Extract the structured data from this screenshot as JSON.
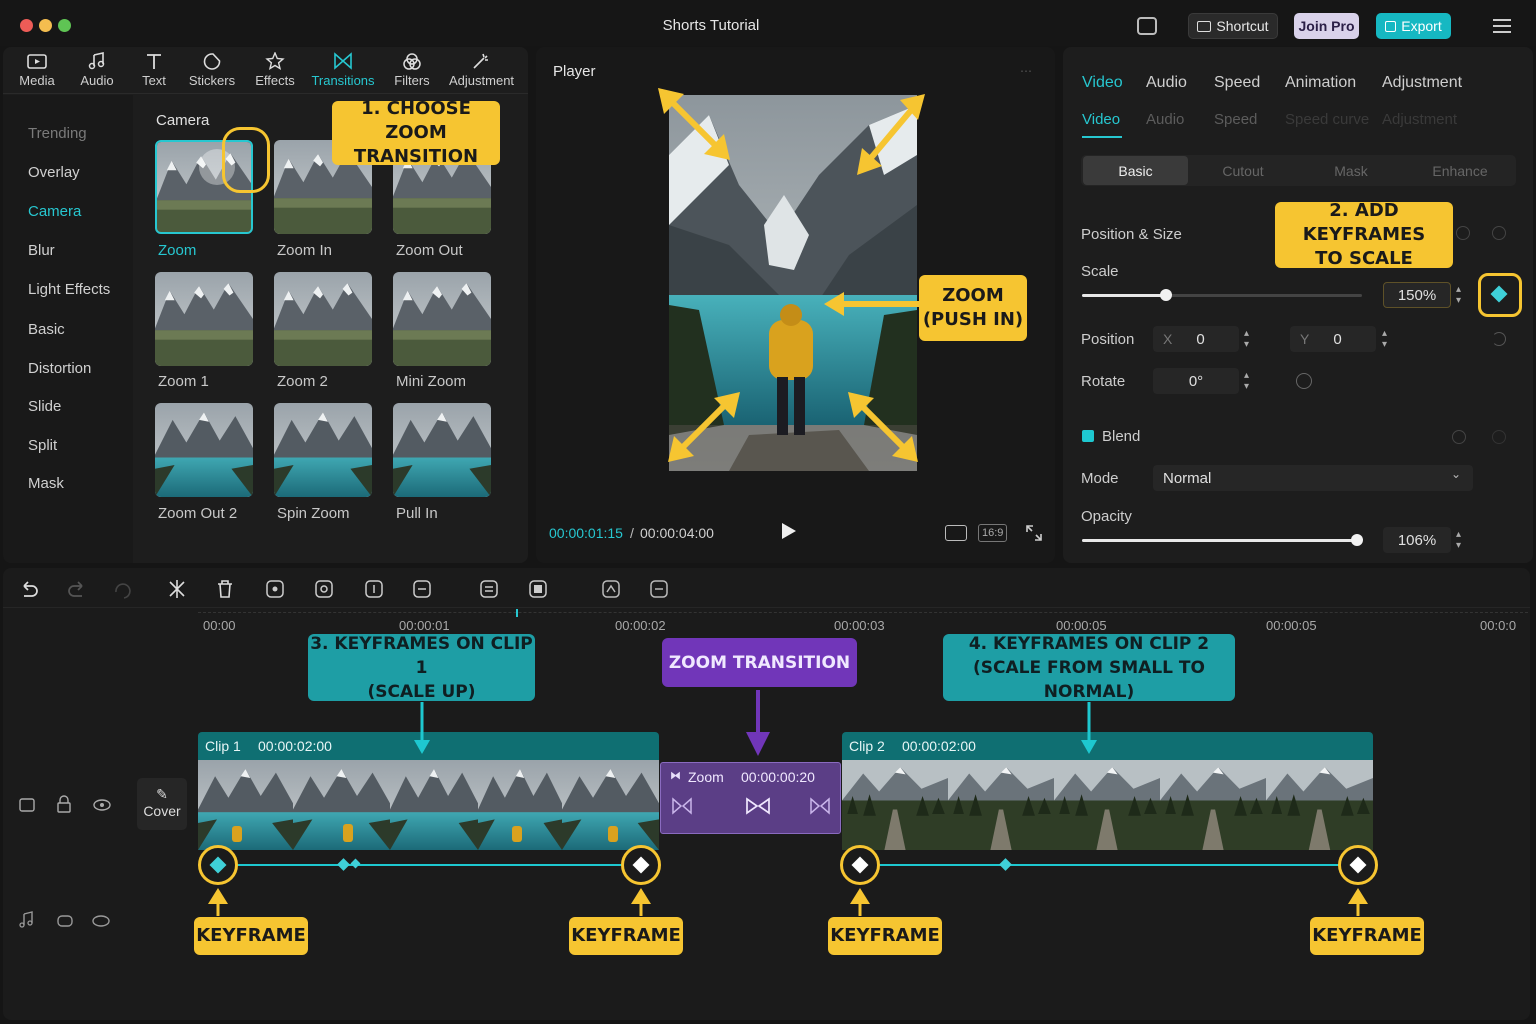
{
  "window": {
    "title": "Shorts Tutorial"
  },
  "header": {
    "shortcut_label": "Shortcut",
    "joinpro_label": "Join Pro",
    "export_label": "Export"
  },
  "toolbar": {
    "items": [
      {
        "label": "Media",
        "icon": "media-icon"
      },
      {
        "label": "Audio",
        "icon": "audio-icon"
      },
      {
        "label": "Text",
        "icon": "text-icon"
      },
      {
        "label": "Stickers",
        "icon": "stickers-icon"
      },
      {
        "label": "Effects",
        "icon": "effects-icon"
      },
      {
        "label": "Transitions",
        "icon": "transitions-icon",
        "active": true
      },
      {
        "label": "Filters",
        "icon": "filters-icon"
      },
      {
        "label": "Adjustment",
        "icon": "adjustment-icon"
      }
    ]
  },
  "categories": [
    "Trending",
    "Overlay",
    "Camera",
    "Blur",
    "Light Effects",
    "Basic",
    "Distortion",
    "Slide",
    "Split",
    "Mask"
  ],
  "active_category": "Camera",
  "transitions": {
    "section_title": "Camera",
    "items": [
      "Zoom",
      "Zoom In",
      "Zoom Out",
      "Zoom 1",
      "Zoom 2",
      "Mini Zoom",
      "Zoom Out 2",
      "Spin Zoom",
      "Pull In"
    ],
    "selected": "Zoom"
  },
  "player": {
    "title": "Player",
    "current_time": "00:00:01:15",
    "separator": "/",
    "total_time": "00:00:04:00",
    "ratio": "16:9"
  },
  "properties": {
    "tabs": [
      "Video",
      "Audio",
      "Speed",
      "Animation",
      "Adjustment"
    ],
    "subtabs": [
      "Video",
      "Audio",
      "Speed",
      "Speed curve",
      "Adjustment"
    ],
    "segments": [
      "Basic",
      "Cutout",
      "Mask",
      "Enhance"
    ],
    "position_size_label": "Position & Size",
    "scale_label": "Scale",
    "scale_value": "150%",
    "scale_fraction": 0.3,
    "position_label": "Position",
    "x_label": "X",
    "x_value": "0",
    "y_label": "Y",
    "y_value": "0",
    "rotate_label": "Rotate",
    "rotate_value": "0°",
    "blend_label": "Blend",
    "mode_label": "Mode",
    "mode_value": "Normal",
    "opacity_label": "Opacity",
    "opacity_value": "106%",
    "opacity_fraction": 0.99
  },
  "timeline": {
    "timecodes": [
      "00:00",
      "00:00:01",
      "00:00:02",
      "00:00:03",
      "00:00:05",
      "00:00:05",
      "00:0:0"
    ],
    "cover_label": "Cover",
    "clip1": {
      "name": "Clip 1",
      "duration": "00:00:02:00"
    },
    "transition": {
      "name": "Zoom",
      "duration": "00:00:00:20"
    },
    "clip2": {
      "name": "Clip 2",
      "duration": "00:00:02:00"
    }
  },
  "callouts": {
    "c1": "1. CHOOSE ZOOM\nTRANSITION",
    "c2": "2. ADD KEYFRAMES\nTO SCALE",
    "c3": "3. KEYFRAMES ON CLIP 1\n(SCALE UP)",
    "c4": "4. KEYFRAMES ON CLIP 2\n(SCALE FROM SMALL TO NORMAL)",
    "zoom_push": "ZOOM\n(PUSH IN)",
    "zoom_transition": "ZOOM TRANSITION",
    "keyframe": "KEYFRAME"
  },
  "colors": {
    "accent": "#1ec8d0",
    "callout_yellow": "#f6c531",
    "callout_teal": "#1e9ea5",
    "callout_purple": "#7136b9",
    "export": "#16b8c2"
  }
}
